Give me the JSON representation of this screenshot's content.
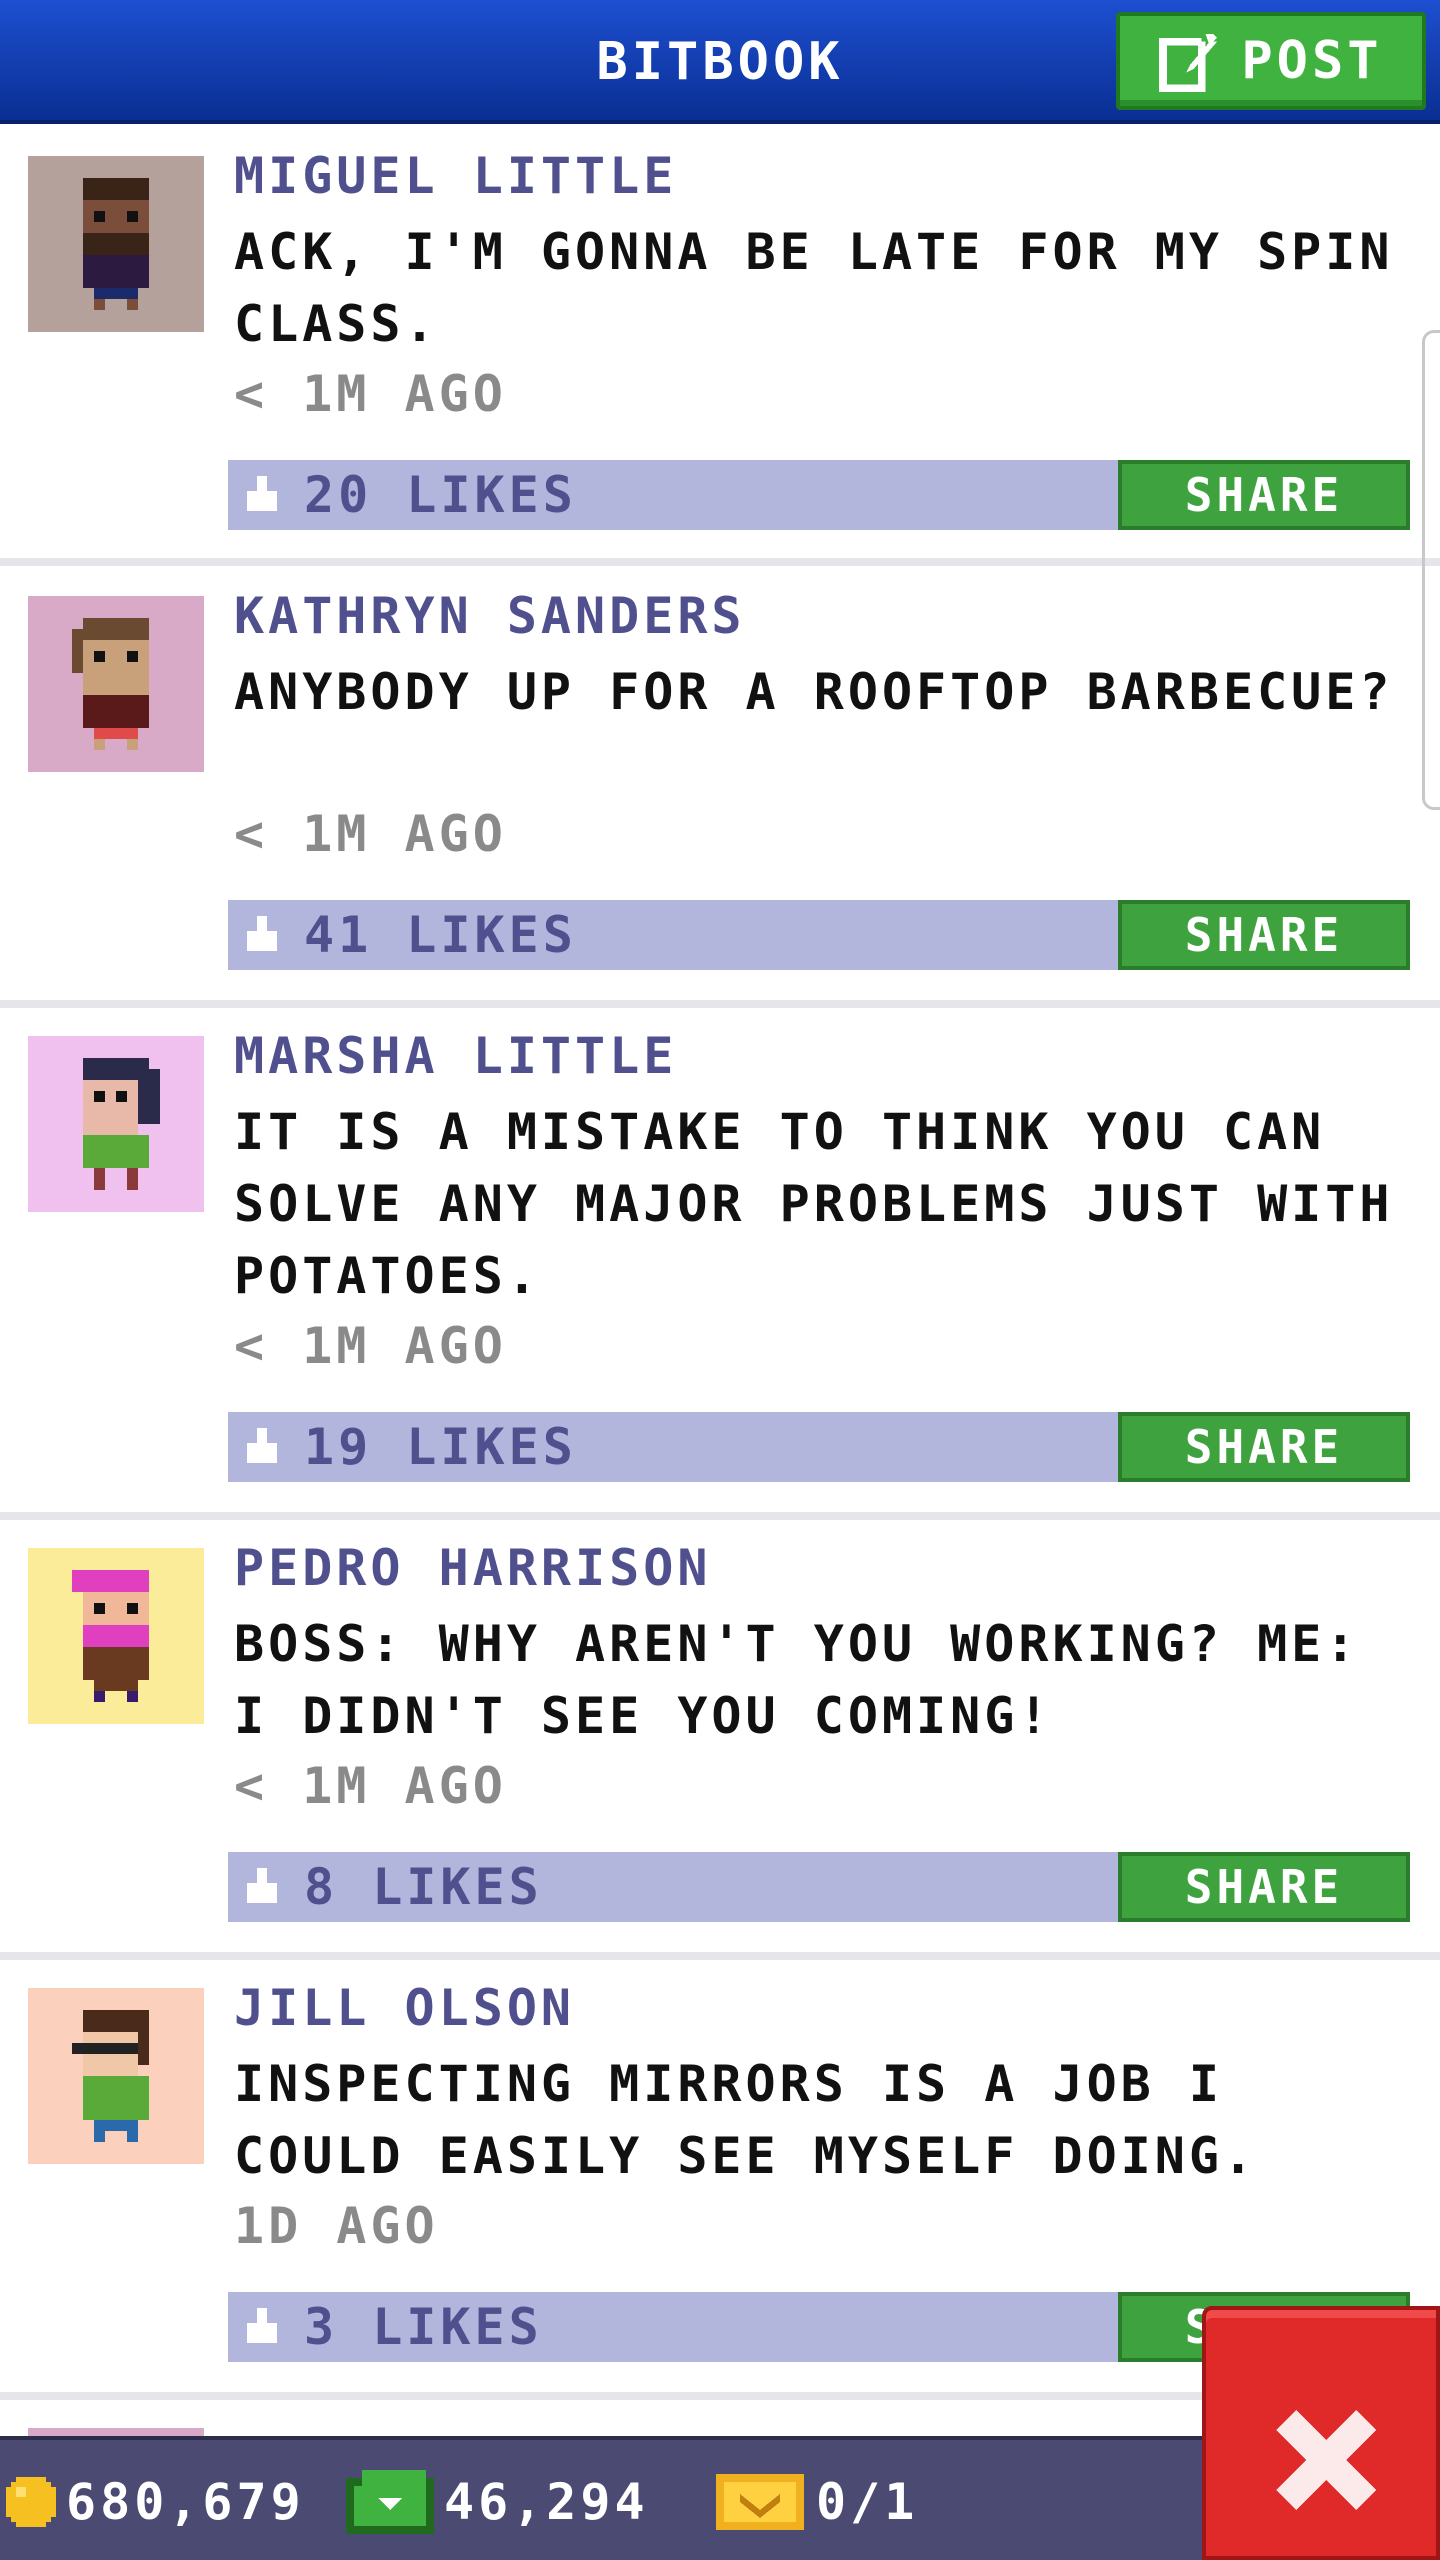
{
  "header": {
    "title": "BITBOOK",
    "post_label": "POST"
  },
  "colors": {
    "header_blue": "#1d4fd0",
    "post_green": "#3fb23f",
    "likes_bar": "#b3b6dc",
    "name_purple": "#50508e",
    "close_red": "#e02a2a"
  },
  "posts": [
    {
      "name": "MIGUEL LITTLE",
      "message": "ACK, I'M GONNA BE LATE FOR MY SPIN CLASS.",
      "time": "< 1M AGO",
      "likes": "20 LIKES",
      "share_label": "SHARE",
      "avatar_bg": "#b5a19c"
    },
    {
      "name": "KATHRYN SANDERS",
      "message": "ANYBODY UP FOR A ROOFTOP BARBECUE?",
      "time": "< 1M AGO",
      "likes": "41 LIKES",
      "share_label": "SHARE",
      "avatar_bg": "#d9a9c8"
    },
    {
      "name": "MARSHA LITTLE",
      "message": "IT IS A MISTAKE TO THINK YOU CAN SOLVE ANY MAJOR PROBLEMS JUST WITH POTATOES.",
      "time": "< 1M AGO",
      "likes": "19 LIKES",
      "share_label": "SHARE",
      "avatar_bg": "#f0c0ee"
    },
    {
      "name": "PEDRO HARRISON",
      "message": "BOSS: WHY AREN'T YOU WORKING? ME: I DIDN'T SEE YOU COMING!",
      "time": "< 1M AGO",
      "likes": "8 LIKES",
      "share_label": "SHARE",
      "avatar_bg": "#faec98"
    },
    {
      "name": "JILL OLSON",
      "message": "INSPECTING MIRRORS IS A JOB I COULD EASILY SEE MYSELF DOING.",
      "time": "1D AGO",
      "likes": "3 LIKES",
      "share_label": "SHARE",
      "avatar_bg": "#fbd0bc"
    }
  ],
  "status": {
    "coins": "680,679",
    "bux": "46,294",
    "tickets": "0/1"
  }
}
